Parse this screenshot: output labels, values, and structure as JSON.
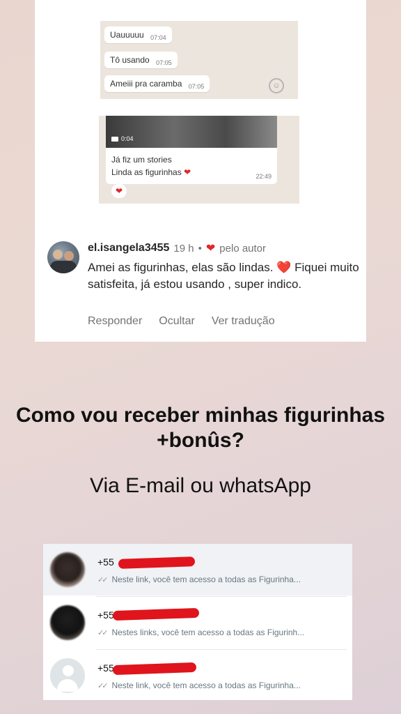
{
  "top_screenshot": {
    "chat1": {
      "messages": [
        {
          "text": "Uauuuuu",
          "time": "07:04"
        },
        {
          "text": "Tô usando",
          "time": "07:05"
        },
        {
          "text": "Ameiii pra caramba",
          "time": "07:05"
        }
      ]
    },
    "chat2": {
      "video_duration": "0:04",
      "line1": "Já fiz um stories",
      "line2": "Linda as figurinhas",
      "heart": "❤",
      "time": "22:49",
      "reaction": "❤"
    },
    "comment": {
      "username": "el.isangela3455",
      "age": "19 h",
      "separator": "•",
      "heart": "❤",
      "liked_by": "pelo autor",
      "text": "Amei as figurinhas, elas são lindas. ❤️ Fiquei muito satisfeita, já estou usando , super indico.",
      "actions": [
        "Responder",
        "Ocultar",
        "Ver tradução"
      ]
    }
  },
  "question": "Como vou receber minhas figurinhas +bonûs?",
  "answer": "Via E-mail ou whatsApp",
  "contacts": [
    {
      "name_prefix": "+55",
      "message": "Neste link, você tem acesso a todas as Figurinha..."
    },
    {
      "name_prefix": "+55",
      "message": "Nestes links, você tem acesso a todas as Figurinh..."
    },
    {
      "name_prefix": "+55",
      "message": "Neste link, você tem acesso a todas as Figurinha..."
    }
  ],
  "colors": {
    "heart": "#e0262a",
    "redaction": "#e0141c",
    "chat_bg": "#ece5dd"
  }
}
